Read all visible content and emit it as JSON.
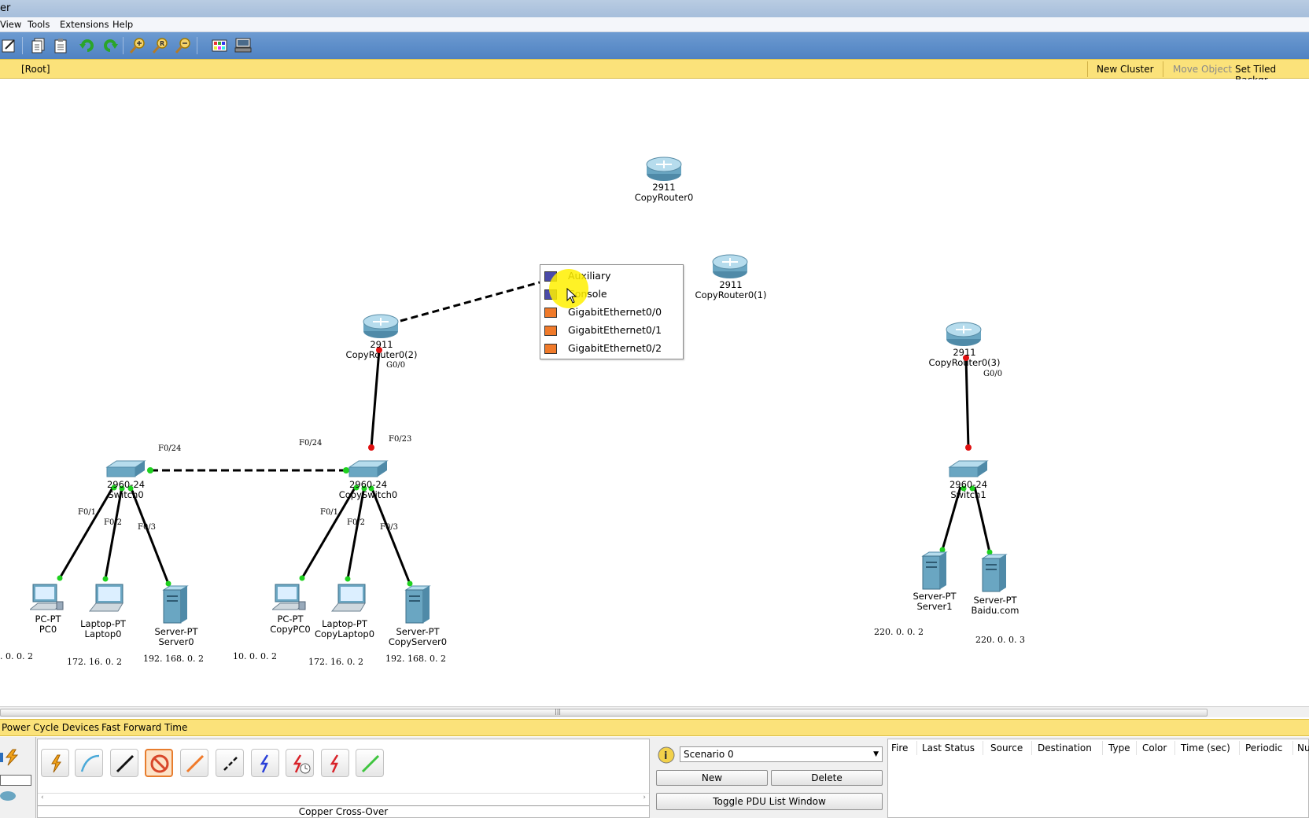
{
  "window": {
    "title_fragment": "er"
  },
  "menu": {
    "items": [
      "View",
      "Tools",
      "Extensions",
      "Help"
    ]
  },
  "toolbar": {
    "icons": [
      "pencil-new-icon",
      "copy-icon",
      "paste-icon",
      "undo-icon",
      "redo-icon",
      "zoom-in-icon",
      "zoom-reset-icon",
      "zoom-out-icon",
      "palette-icon",
      "device-dialog-icon"
    ]
  },
  "logical_bar": {
    "root": "[Root]",
    "new_cluster": "New Cluster",
    "move_object": "Move Object",
    "set_tiled": "Set Tiled Backgr"
  },
  "devices": {
    "router0": {
      "model": "2911",
      "name": "CopyRouter0"
    },
    "router1": {
      "model": "2911",
      "name": "CopyRouter0(1)"
    },
    "router2": {
      "model": "2911",
      "name": "CopyRouter0(2)"
    },
    "router3": {
      "model": "2911",
      "name": "CopyRouter0(3)"
    },
    "switch0": {
      "model": "2960-24",
      "name": "Switch0"
    },
    "copyswitch0": {
      "model": "2960-24",
      "name": "CopySwitch0"
    },
    "switch1": {
      "model": "2960-24",
      "name": "Switch1"
    },
    "pc0": {
      "model": "PC-PT",
      "name": "PC0"
    },
    "laptop0": {
      "model": "Laptop-PT",
      "name": "Laptop0"
    },
    "server0": {
      "model": "Server-PT",
      "name": "Server0"
    },
    "copypc0": {
      "model": "PC-PT",
      "name": "CopyPC0"
    },
    "copylaptop0": {
      "model": "Laptop-PT",
      "name": "CopyLaptop0"
    },
    "copyserver0": {
      "model": "Server-PT",
      "name": "CopyServer0"
    },
    "server1": {
      "model": "Server-PT",
      "name": "Server1"
    },
    "baidu": {
      "model": "Server-PT",
      "name": "Baidu.com"
    }
  },
  "ports": {
    "g00_r2": "G0/0",
    "f023": "F0/23",
    "f024_left": "F0/24",
    "f024_right": "F0/24",
    "g00_r3": "G0/0",
    "s0_f01": "F0/1",
    "s0_f02": "F0/2",
    "s0_f03": "F0/3",
    "cs_f01": "F0/1",
    "cs_f02": "F0/2",
    "cs_f03": "F0/3"
  },
  "addresses": {
    "a1": ". 0. 0. 2",
    "a2": "172. 16. 0. 2",
    "a3": "192. 168. 0. 2",
    "a4": "10. 0. 0. 2",
    "a5": "172. 16. 0. 2",
    "a6": "192. 168. 0. 2",
    "a7": "220. 0. 0. 2",
    "a8": "220. 0. 0. 3"
  },
  "port_menu": {
    "items": [
      {
        "label": "Auxiliary",
        "color": "#4b4ba8"
      },
      {
        "label": "Console",
        "color": "#4b4ba8"
      },
      {
        "label": "GigabitEthernet0/0",
        "color": "#f07a2a"
      },
      {
        "label": "GigabitEthernet0/1",
        "color": "#f07a2a"
      },
      {
        "label": "GigabitEthernet0/2",
        "color": "#f07a2a"
      }
    ]
  },
  "realtime_bar": {
    "power_cycle": "Power Cycle Devices",
    "fast_forward": "Fast Forward Time"
  },
  "connections": {
    "selected_type": "Copper Cross-Over"
  },
  "scenario": {
    "selected": "Scenario 0",
    "new_label": "New",
    "delete_label": "Delete",
    "toggle_label": "Toggle PDU List Window"
  },
  "pdu_table": {
    "headers": [
      "Fire",
      "Last Status",
      "Source",
      "Destination",
      "Type",
      "Color",
      "Time (sec)",
      "Periodic",
      "Num"
    ]
  },
  "colors": {
    "link_up": "#1fd11f",
    "link_down": "#e01010",
    "toolbar": "#5a8bc8",
    "yellow_bar": "#fbe27a"
  }
}
